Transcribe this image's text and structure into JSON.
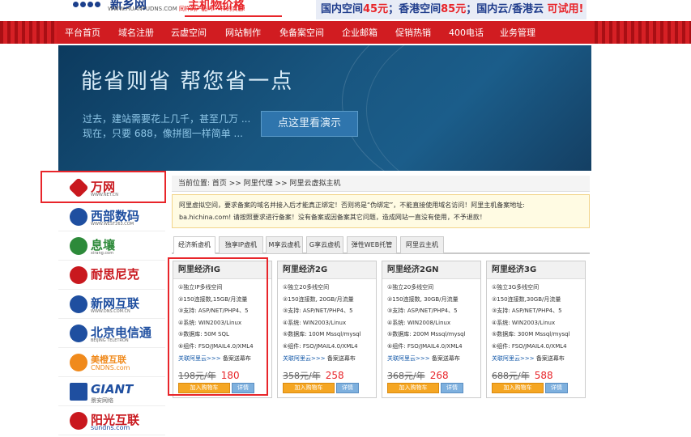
{
  "header": {
    "logo_text": "新乡网",
    "logo_url_text": "WWW.HUANYUDNS.COM",
    "logo_tagline": "同样的产品 不一样的实惠!",
    "slogan": "主机物价格",
    "promo_parts": [
      "国内空间",
      "45元",
      "；香港空间",
      "85元",
      "；国内云/香港云 ",
      "可试用!"
    ]
  },
  "nav": {
    "items": [
      "平台首页",
      "域名注册",
      "云虚空间",
      "网站制作",
      "免备案空间",
      "企业邮箱",
      "促销热销",
      "400电话",
      "业务管理"
    ]
  },
  "banner": {
    "headline": "能省则省 帮您省一点",
    "line1": "过去，建站需要花上几千，甚至几万 ...",
    "line2": "现在，只要 688，像拼图一样简单 ...",
    "demo_button": "点这里看演示"
  },
  "partners": [
    {
      "name": "万网",
      "sub": "WWW.NET.CN",
      "color": "#c9181e"
    },
    {
      "name": "西部数码",
      "sub": "WWW.WEST263.COM",
      "color": "#1f4fa0"
    },
    {
      "name": "息壤",
      "sub": "xirang.com",
      "color": "#2d8a3a"
    },
    {
      "name": "耐思尼克",
      "sub": "",
      "color": "#c9181e"
    },
    {
      "name": "新网互联",
      "sub": "WWW.DNS.COM.CN",
      "color": "#1f4fa0"
    },
    {
      "name": "北京电信通",
      "sub": "BEIJING TELETRON",
      "color": "#1f4fa0"
    },
    {
      "name": "美橙互联",
      "sub": "CNDNS.com",
      "color": "#f08a1c"
    },
    {
      "name": "GIANT",
      "sub": "景安网络",
      "color": "#1f4fa0"
    },
    {
      "name": "阳光互联",
      "sub": "sundns.com",
      "color": "#c9181e"
    }
  ],
  "breadcrumb": "当前位置: 首页 >> 阿里代理 >> 阿里云虚拟主机",
  "notice": {
    "line1": "阿里虚拟空间，要求备案的域名并接入后才能真正绑定！否则将是“伪绑定”，不能直接使用域名访问！阿里主机备案地址:",
    "line2": "ba.hichina.com! 请按照要求进行备案！没有备案或因备案其它问题，造成网站一直没有使用，不予退款！"
  },
  "tabs": [
    "经济新虚机",
    "独享IP虚机",
    "M享云虚机",
    "G享云虚机",
    "弹性WEB托管",
    "阿里云主机"
  ],
  "products": [
    {
      "title": "阿里经济IG",
      "features": [
        "①独立IP多线空间",
        "②150连接数,15GB/月流量",
        "③支持: ASP/NET/PHP4、5",
        "④系统: WIN2003/Linux",
        "⑤数据库: 50M SQL",
        "⑥组件: FSO/JMAIL4.0/XML4"
      ],
      "link": "关联阿里云>>>",
      "link_note": "备案送幕布",
      "old_price": "198元/年",
      "price": "180"
    },
    {
      "title": "阿里经济2G",
      "features": [
        "①独立20多线空间",
        "②150连接数, 20GB/月流量",
        "③支持: ASP/NET/PHP4、5",
        "④系统: WIN2003/Linux",
        "⑤数据库: 100M Mssql/mysql",
        "⑥组件: FSO/JMAIL4.0/XML4"
      ],
      "link": "关联阿里云>>>",
      "link_note": "备案送幕布",
      "old_price": "358元/年",
      "price": "258"
    },
    {
      "title": "阿里经济2GN",
      "features": [
        "①独立20多线空间",
        "②150连接数, 30GB/月流量",
        "③支持: ASP/NET/PHP4、5",
        "④系统: WIN2008/Linux",
        "⑤数据库: 200M Mssql/mysql",
        "⑥组件: FSO/JMAIL4.0/XML4"
      ],
      "link": "关联阿里云>>>",
      "link_note": "备案送幕布",
      "old_price": "368元/年",
      "price": "268"
    },
    {
      "title": "阿里经济3G",
      "features": [
        "①独立3G多线空间",
        "②150连接数,30GB/月流量",
        "③支持: ASP/NET/PHP4、5",
        "④系统: WIN2003/Linux",
        "⑤数据库: 300M Mssql/mysql",
        "⑥组件: FSO/JMAIL4.0/XML4"
      ],
      "link": "关联阿里云>>>",
      "link_note": "备案送幕布",
      "old_price": "688元/年",
      "price": "588"
    }
  ],
  "buttons": {
    "cart": "加入购物车",
    "detail": "详情"
  }
}
